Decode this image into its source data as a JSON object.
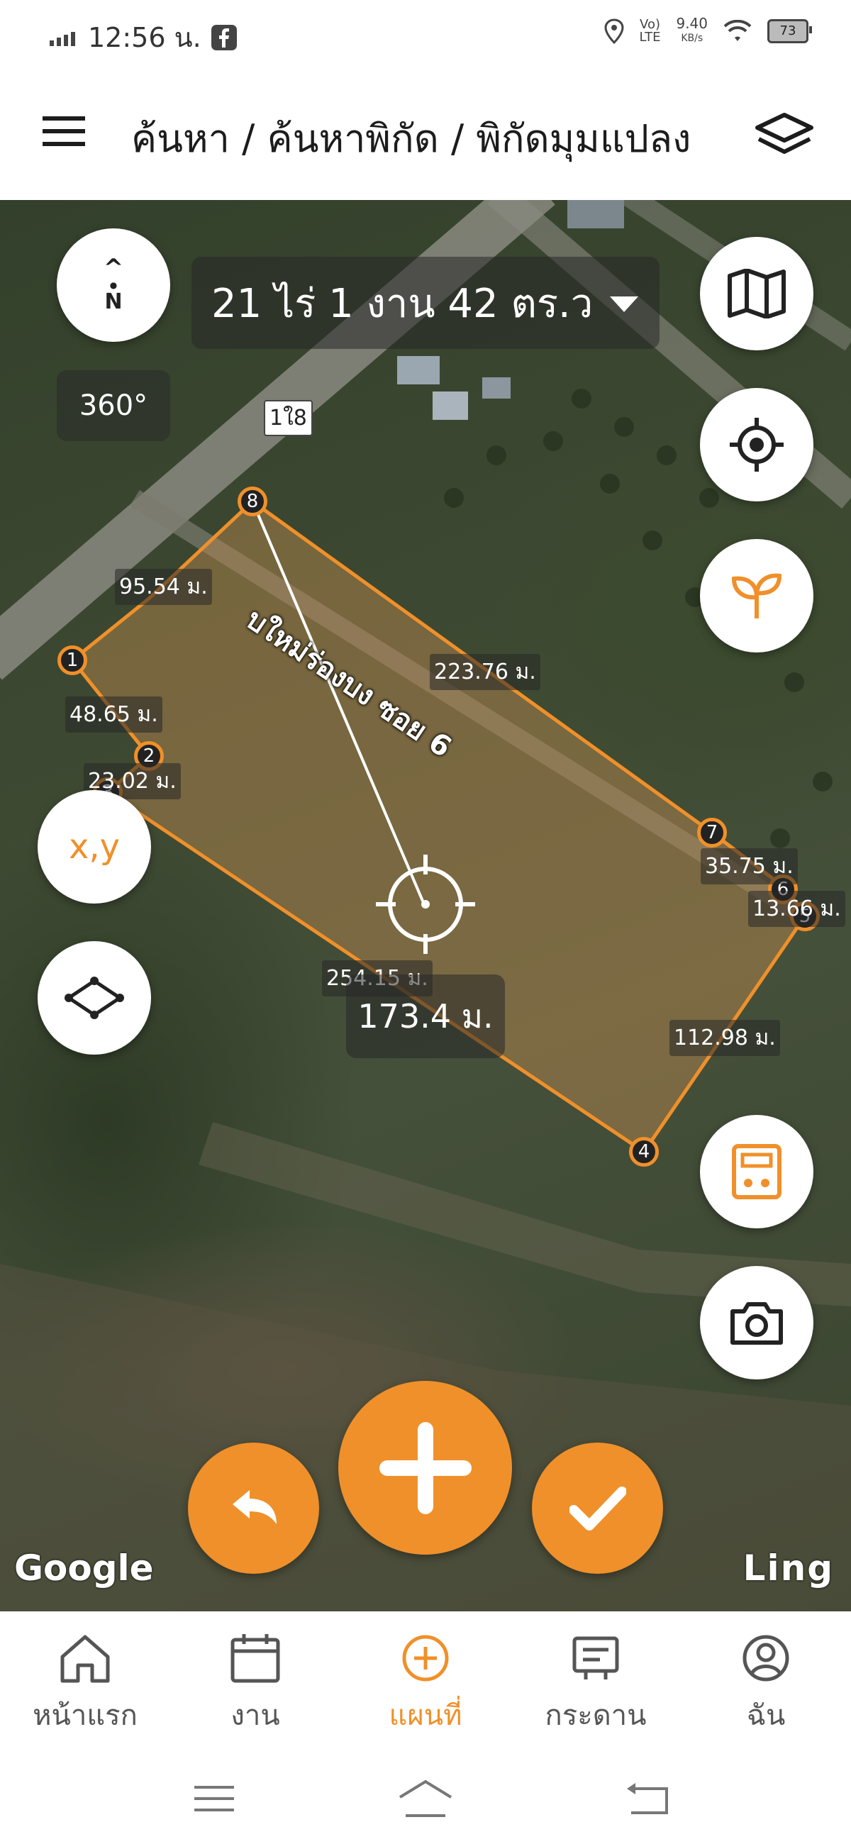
{
  "status_bar": {
    "time": "12:56 น.",
    "net_speed": "9.40",
    "net_unit": "KB/s",
    "battery": "73"
  },
  "header": {
    "breadcrumb": "ค้นหา / ค้นหาพิกัด / พิกัดมุมแปลง"
  },
  "map": {
    "compass_label": "N",
    "area_text": "21 ไร่ 1 งาน 42 ตร.ว",
    "rotation": "360°",
    "road_number": "1ใ8",
    "road_name": "บใหม่ร่องบง ซอย 6",
    "distance_readout": "173.4 ม.",
    "xy_label": "x,y",
    "edges": [
      {
        "label": "95.54 ม."
      },
      {
        "label": "48.65 ม."
      },
      {
        "label": "23.02 ม."
      },
      {
        "label": "223.76 ม."
      },
      {
        "label": "35.75 ม."
      },
      {
        "label": "13.66 ม."
      },
      {
        "label": "112.98 ม."
      },
      {
        "label": "254.15 ม."
      }
    ],
    "vertices": [
      "1",
      "2",
      "3",
      "4",
      "5",
      "6",
      "7",
      "8"
    ],
    "attribution_left": "Google",
    "attribution_right": "Ling"
  },
  "bottom_nav": [
    {
      "label": "หน้าแรก",
      "icon": "home-icon"
    },
    {
      "label": "งาน",
      "icon": "calendar-icon"
    },
    {
      "label": "แผนที่",
      "icon": "add-circle-icon",
      "active": true
    },
    {
      "label": "กระดาน",
      "icon": "board-icon"
    },
    {
      "label": "ฉัน",
      "icon": "profile-icon"
    }
  ],
  "colors": {
    "accent": "#f0902a",
    "text_dark": "#1c1c1c"
  }
}
